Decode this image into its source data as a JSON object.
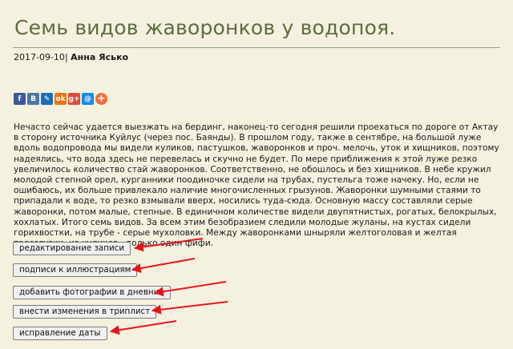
{
  "page": {
    "title": "Семь видов жаворонков у водопоя.",
    "date": "2017-09-10",
    "separator": "|",
    "author": "Анна Ясько"
  },
  "share": [
    {
      "icon": "facebook-icon",
      "glyph": "f",
      "color": "#3b5998"
    },
    {
      "icon": "vkontakte-icon",
      "glyph": "B",
      "color": "#4c75a3"
    },
    {
      "icon": "livejournal-icon",
      "glyph": "✎",
      "color": "#1a6fb5"
    },
    {
      "icon": "odnoklassniki-icon",
      "glyph": "ok",
      "color": "#f2720c"
    },
    {
      "icon": "google-plus-icon",
      "glyph": "g+",
      "color": "#dd4b39"
    },
    {
      "icon": "mail-icon",
      "glyph": "@",
      "color": "#168de2"
    },
    {
      "icon": "more-share-icon",
      "glyph": "+",
      "color": "#ef6b3b"
    }
  ],
  "article": {
    "text": "Нечасто сейчас удается выезжать на бердинг, наконец-то сегодня решили проехаться по дороге от Актау в сторону источника Куйлус (через пос. Баянды). В прошлом году, также в сентябре, на большой луже вдоль водопровода мы видели куликов, пастушков, жаворонков и проч. мелочь, уток и хищников, поэтому надеялись, что вода здесь не перевелась и скучно не будет. По мере приближения к этой луже резко увеличилось количество стай жаворонков. Соответственно, не обошлось и без хищников. В небе кружил молодой степной орел, курганники поодиночке сидели на трубах, пустельга тоже начеку. Но, если не ошибаюсь, их больше привлекало наличие многочисленных грызунов. Жаворонки шумными стаями то припадали к воде, то резко взмывали вверх, носились туда-сюда. Основную массу составляли серые жаворонки, потом малые, степные. В единичном количестве видели двупятнистых, рогатых, белокрылых, хохлатых. Итого семь видов. За всем этим безобразием следили молодые жуланы, на кустах сидели горихвостки, на трубе - серые мухоловки. Между жаворонками шныряли желтоголовая и желтая трясогузки, из куликов - только один фифи."
  },
  "actions": [
    {
      "name": "edit-post-button",
      "label": "редактирование записи"
    },
    {
      "name": "illustration-captions-button",
      "label": "подписи к иллюстрациям"
    },
    {
      "name": "add-photos-button",
      "label": "добавить фотографии в дневник"
    },
    {
      "name": "edit-triplist-button",
      "label": "внести изменения в триплист"
    },
    {
      "name": "fix-date-button",
      "label": "исправление даты"
    }
  ],
  "colors": {
    "title": "#5d6c40",
    "background": "#f4f1df",
    "annotation_arrow": "#e8141c"
  }
}
